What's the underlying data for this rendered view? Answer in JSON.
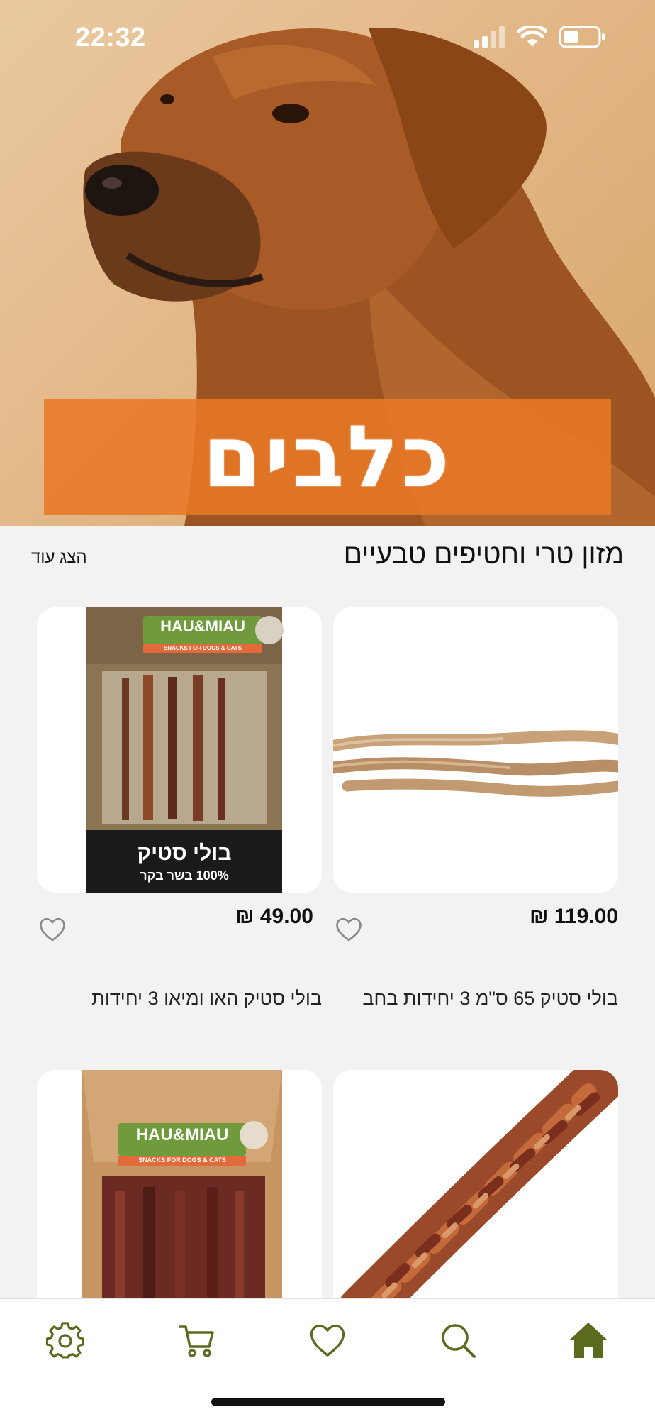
{
  "status_bar": {
    "time": "22:32"
  },
  "hero": {
    "banner_text": "כלבים"
  },
  "section": {
    "title": "מזון טרי וחטיפים טבעיים",
    "show_more": "הצג עוד"
  },
  "products": [
    {
      "name": "בולי סטיק 65 ס\"מ 3 יחידות בחב",
      "price": "₪ 119.00"
    },
    {
      "name": "בולי סטיק האו ומיאו 3 יחידות",
      "price": "₪ 49.00",
      "package": {
        "brand": "HAU&MIAU",
        "tagline": "SNACKS FOR DOGS & CATS",
        "label_title": "בולי סטיק",
        "label_sub": "100% בשר בקר"
      }
    },
    {
      "name": "",
      "price": ""
    },
    {
      "name": "",
      "price": "",
      "package": {
        "brand": "HAU&MIAU",
        "tagline": "SNACKS FOR DOGS & CATS"
      }
    }
  ],
  "bottom_nav": [
    {
      "name": "settings",
      "icon": "gear-icon"
    },
    {
      "name": "cart",
      "icon": "cart-icon"
    },
    {
      "name": "favorites",
      "icon": "heart-icon"
    },
    {
      "name": "search",
      "icon": "search-icon"
    },
    {
      "name": "home",
      "icon": "home-icon"
    }
  ],
  "colors": {
    "accent": "#5a6b1f",
    "banner": "#e97926",
    "background": "#f2f2f2"
  }
}
